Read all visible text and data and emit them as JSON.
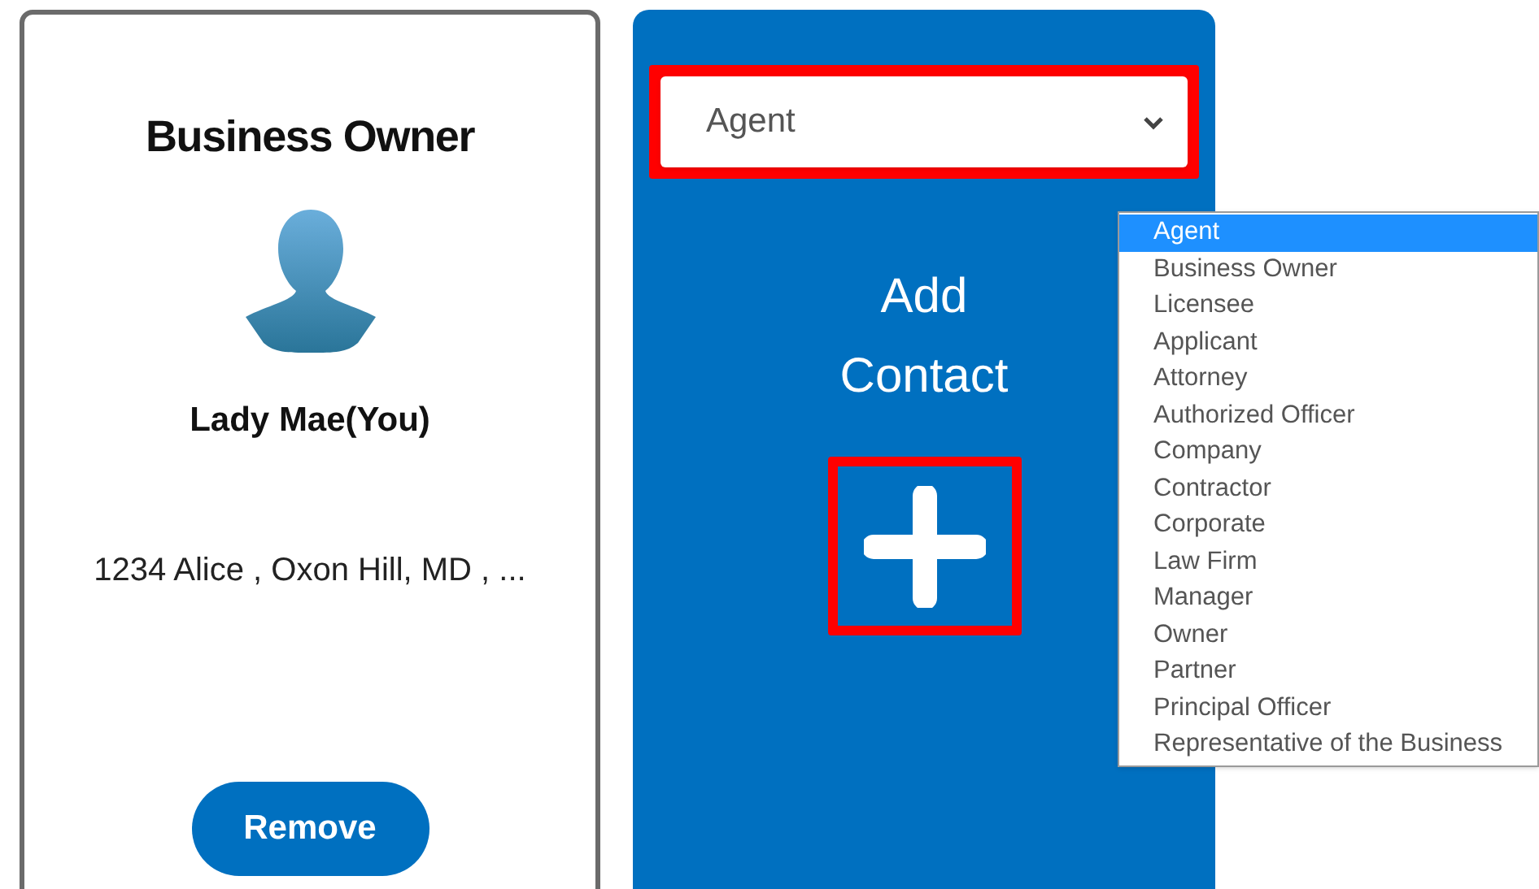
{
  "owner_card": {
    "role": "Business Owner",
    "name": "Lady Mae(You)",
    "address": "1234 Alice , Oxon Hill, MD , ...",
    "remove_button": "Remove"
  },
  "add_card": {
    "select": {
      "value": "Agent",
      "highlighted": true
    },
    "title": "Add Contact",
    "add_button": {
      "highlighted": true
    }
  },
  "dropdown": {
    "options": [
      {
        "label": "Agent",
        "selected": true
      },
      {
        "label": "Business Owner",
        "selected": false
      },
      {
        "label": "Licensee",
        "selected": false
      },
      {
        "label": "Applicant",
        "selected": false
      },
      {
        "label": "Attorney",
        "selected": false
      },
      {
        "label": "Authorized Officer",
        "selected": false
      },
      {
        "label": "Company",
        "selected": false
      },
      {
        "label": "Contractor",
        "selected": false
      },
      {
        "label": "Corporate",
        "selected": false
      },
      {
        "label": "Law Firm",
        "selected": false
      },
      {
        "label": "Manager",
        "selected": false
      },
      {
        "label": "Owner",
        "selected": false
      },
      {
        "label": "Partner",
        "selected": false
      },
      {
        "label": "Principal Officer",
        "selected": false
      },
      {
        "label": "Representative of the Business",
        "selected": false
      }
    ]
  }
}
